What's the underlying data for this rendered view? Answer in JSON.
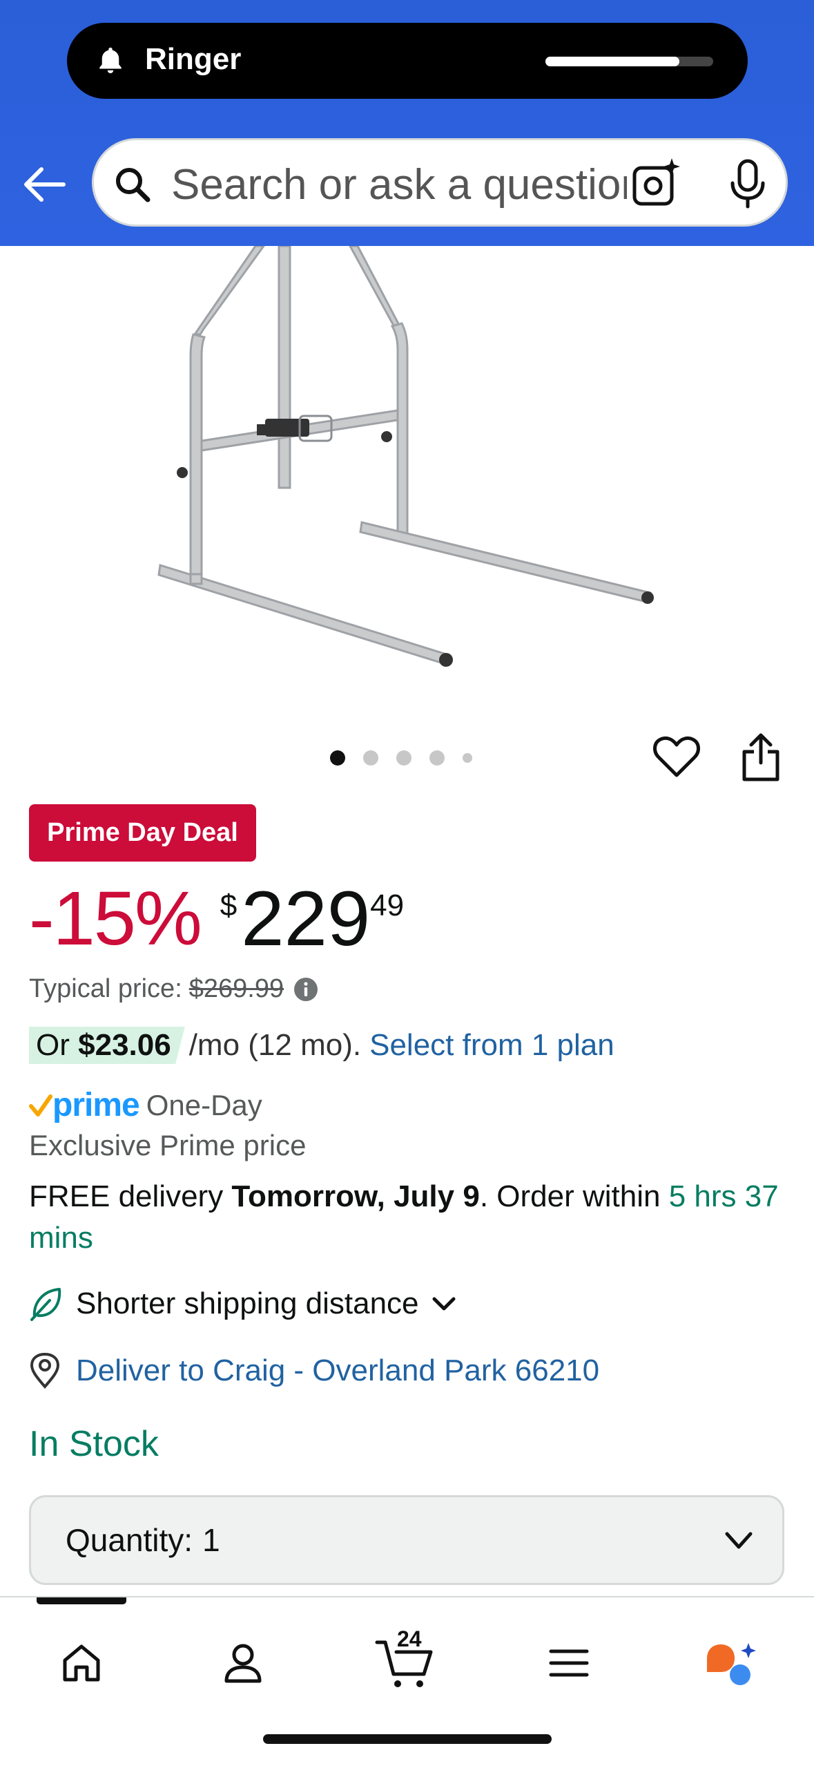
{
  "status_bar": {
    "ringer_label": "Ringer",
    "volume_level": 0.8
  },
  "header": {
    "search_placeholder": "Search or ask a question"
  },
  "gallery": {
    "image_count": 5,
    "active_index": 0
  },
  "deal": {
    "badge": "Prime Day Deal",
    "discount": "-15%",
    "currency_symbol": "$",
    "price_whole": "229",
    "price_fraction": "49",
    "typical_label": "Typical price:",
    "typical_price": "$269.99"
  },
  "installment": {
    "prefix": "Or",
    "amount": "$23.06",
    "per": "/mo (12 mo).",
    "link": "Select from 1 plan"
  },
  "prime": {
    "logo_text": "prime",
    "label": "One-Day",
    "exclusive": "Exclusive Prime price"
  },
  "delivery": {
    "prefix": "FREE delivery",
    "date": "Tomorrow, July 9",
    "middle": ". Order within",
    "countdown": "5 hrs 37 mins"
  },
  "shipping": {
    "label": "Shorter shipping distance"
  },
  "location": {
    "label": "Deliver to Craig - Overland Park 66210"
  },
  "stock": {
    "status": "In Stock"
  },
  "quantity": {
    "label": "Quantity:",
    "value": "1"
  },
  "bottom_nav": {
    "cart_count": "24",
    "items": [
      "home-icon",
      "account-icon",
      "cart-icon",
      "menu-icon",
      "rufus-icon"
    ]
  },
  "colors": {
    "header_blue": "#2f62e0",
    "deal_red": "#cc0c39",
    "link_blue": "#2162a1",
    "stock_green": "#067d62",
    "prime_blue": "#1a98ff"
  }
}
